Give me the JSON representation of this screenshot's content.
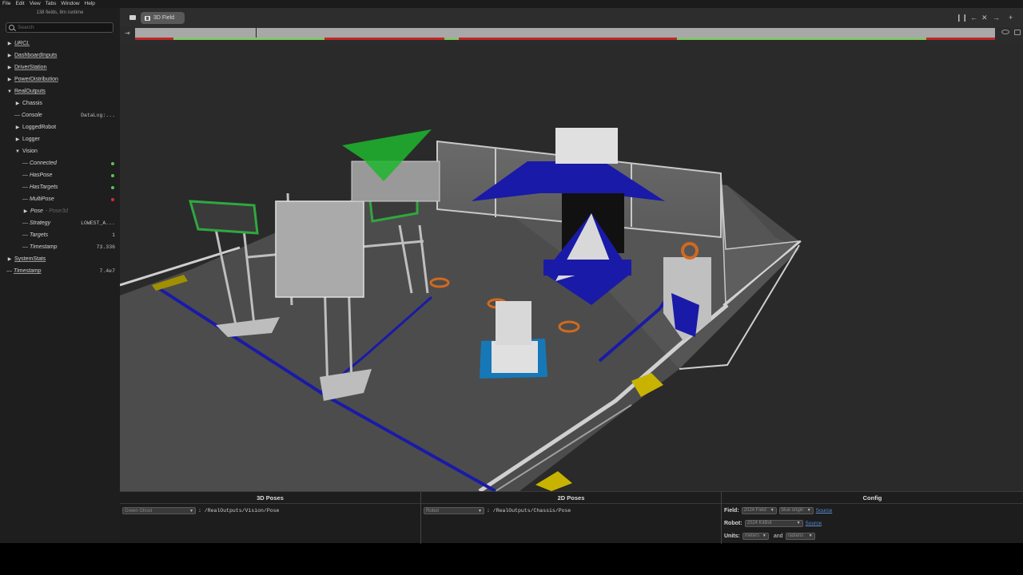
{
  "menu": [
    "File",
    "Edit",
    "View",
    "Tabs",
    "Window",
    "Help"
  ],
  "sidebar": {
    "field_count": "138 fields, 8m runtime",
    "search_placeholder": "Search",
    "tree": [
      {
        "label": "URCL",
        "indent": 0,
        "kind": "closed",
        "italic": true,
        "underline": true
      },
      {
        "label": "DashboardInputs",
        "indent": 0,
        "kind": "closed",
        "underline": true
      },
      {
        "label": "DriverStation",
        "indent": 0,
        "kind": "closed",
        "underline": true
      },
      {
        "label": "PowerDistribution",
        "indent": 0,
        "kind": "closed",
        "underline": true
      },
      {
        "label": "RealOutputs",
        "indent": 0,
        "kind": "open",
        "underline": true
      },
      {
        "label": "Chassis",
        "indent": 1,
        "kind": "closed"
      },
      {
        "label": "Console",
        "indent": 1,
        "kind": "leaf",
        "italic": true,
        "value": "DataLog:..."
      },
      {
        "label": "LoggedRobot",
        "indent": 1,
        "kind": "closed"
      },
      {
        "label": "Logger",
        "indent": 1,
        "kind": "closed"
      },
      {
        "label": "Vision",
        "indent": 1,
        "kind": "open"
      },
      {
        "label": "Connected",
        "indent": 2,
        "kind": "leaf",
        "italic": true,
        "dot": "#5cc05c"
      },
      {
        "label": "HasPose",
        "indent": 2,
        "kind": "leaf",
        "italic": true,
        "dot": "#5cc05c"
      },
      {
        "label": "HasTargets",
        "indent": 2,
        "kind": "leaf",
        "italic": true,
        "dot": "#5cc05c"
      },
      {
        "label": "MultiPose",
        "indent": 2,
        "kind": "leaf",
        "italic": true,
        "dot": "#d03030"
      },
      {
        "label": "Pose",
        "indent": 2,
        "kind": "closed",
        "italic": true,
        "sub": "- Pose3d"
      },
      {
        "label": "Strategy",
        "indent": 2,
        "kind": "leaf",
        "italic": true,
        "value": "LOWEST_A..."
      },
      {
        "label": "Targets",
        "indent": 2,
        "kind": "leaf",
        "italic": true,
        "value": "1"
      },
      {
        "label": "Timestamp",
        "indent": 2,
        "kind": "leaf",
        "italic": true,
        "value": "73.336"
      },
      {
        "label": "SystemStats",
        "indent": 0,
        "kind": "closed",
        "underline": true
      },
      {
        "label": "Timestamp",
        "indent": 0,
        "kind": "leaf",
        "italic": true,
        "underline": true,
        "value": "7.4e7"
      }
    ]
  },
  "tabs": {
    "active_label": "3D Field"
  },
  "timeline": {
    "cursor_fraction": 0.14,
    "segments": [
      {
        "start": 0.0,
        "end": 0.045,
        "color": "#c0282a"
      },
      {
        "start": 0.045,
        "end": 0.22,
        "color": "#86c46a"
      },
      {
        "start": 0.22,
        "end": 0.36,
        "color": "#c0282a"
      },
      {
        "start": 0.36,
        "end": 0.376,
        "color": "#86c46a"
      },
      {
        "start": 0.376,
        "end": 0.63,
        "color": "#c0282a"
      },
      {
        "start": 0.63,
        "end": 0.92,
        "color": "#86c46a"
      },
      {
        "start": 0.92,
        "end": 1.0,
        "color": "#c0282a"
      }
    ]
  },
  "panels": {
    "poses3d": {
      "title": "3D Poses",
      "select": "Green Ghost",
      "path": ": /RealOutputs/Vision/Pose"
    },
    "poses2d": {
      "title": "2D Poses",
      "select": "Robot",
      "path": ": /RealOutputs/Chassis/Pose"
    },
    "config": {
      "title": "Config",
      "field_label": "Field:",
      "field_select": "2024 Field",
      "origin_select": "blue origin",
      "source_label": "Source",
      "robot_label": "Robot:",
      "robot_select": "2024 KitBot",
      "units_label": "Units:",
      "units_length": "meters",
      "units_and": "and",
      "units_angle": "radians"
    }
  },
  "colors": {
    "alliance_blue": "#1a1aa8",
    "ghost_green": "#1fb52e",
    "note_orange": "#d2691e",
    "stage_yellow": "#c8b400"
  }
}
